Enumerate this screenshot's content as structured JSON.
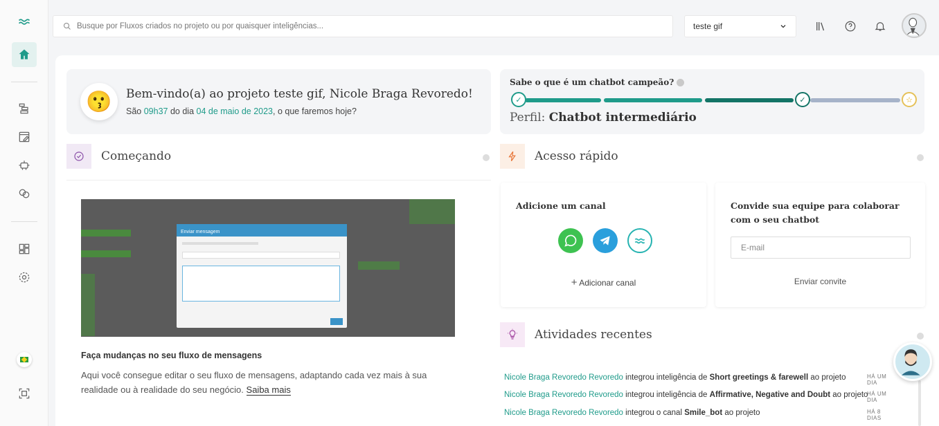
{
  "search": {
    "placeholder": "Busque por Fluxos criados no projeto ou por quaisquer inteligências..."
  },
  "project": {
    "selected": "teste gif"
  },
  "welcome": {
    "title": "Bem-vindo(a) ao projeto teste gif, Nicole Braga Revoredo!",
    "sub_prefix": "São ",
    "time": "09h37",
    "sub_mid": " do dia ",
    "date": "04 de maio de 2023",
    "sub_suffix": ", o que faremos hoje?"
  },
  "chatbot_progress": {
    "title": "Sabe o que é um chatbot campeão?",
    "profile_label": "Perfil:",
    "profile_value": "Chatbot intermediário",
    "level": 0.75
  },
  "sections": {
    "start": "Começando",
    "quick": "Acesso rápido",
    "activities": "Atividades recentes"
  },
  "start_card": {
    "heading": "Faça mudanças no seu fluxo de mensagens",
    "text": "Aqui você consegue editar o seu fluxo de mensagens, adaptando cada vez mais à sua realidade ou à realidade do seu negócio.",
    "link": "Saiba mais",
    "gif_modal_title": "Enviar mensagem"
  },
  "quick_access": {
    "channel_title": "Adicione um canal",
    "add_channel": "Adicionar canal",
    "invite_title": "Convide sua equipe para colaborar com o seu chatbot",
    "email_placeholder": "E-mail",
    "invite_button": "Enviar convite"
  },
  "activities": [
    {
      "user": "Nicole Braga Revoredo Revoredo",
      "pre": " integrou inteligência de ",
      "target": "Short greetings & farewell",
      "post": " ao projeto",
      "time": "HÁ UM DIA"
    },
    {
      "user": "Nicole Braga Revoredo Revoredo",
      "pre": " integrou inteligência de ",
      "target": "Affirmative, Negative and Doubt",
      "post": " ao projeto",
      "time": "HÁ UM DIA"
    },
    {
      "user": "Nicole Braga Revoredo Revoredo",
      "pre": " integrou o canal ",
      "target": "Smile_bot",
      "post": " ao projeto",
      "time": "HÁ 8 DIAS"
    }
  ],
  "colors": {
    "accent": "#1f9b8a",
    "accent_dark": "#137466",
    "progress_rest": "#a6b3c9"
  }
}
